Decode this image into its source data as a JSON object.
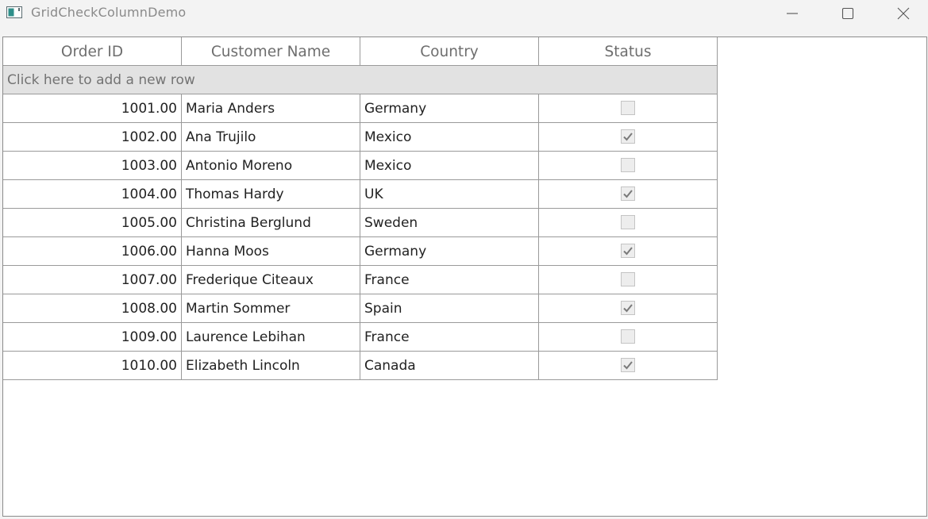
{
  "window": {
    "title": "GridCheckColumnDemo"
  },
  "grid": {
    "columns": [
      "Order ID",
      "Customer Name",
      "Country",
      "Status"
    ],
    "add_row_text": "Click here to add a new row",
    "rows": [
      {
        "order_id": "1001.00",
        "customer": "Maria Anders",
        "country": "Germany",
        "status": false
      },
      {
        "order_id": "1002.00",
        "customer": "Ana Trujilo",
        "country": "Mexico",
        "status": true
      },
      {
        "order_id": "1003.00",
        "customer": "Antonio Moreno",
        "country": "Mexico",
        "status": false
      },
      {
        "order_id": "1004.00",
        "customer": "Thomas Hardy",
        "country": "UK",
        "status": true
      },
      {
        "order_id": "1005.00",
        "customer": "Christina Berglund",
        "country": "Sweden",
        "status": false
      },
      {
        "order_id": "1006.00",
        "customer": "Hanna Moos",
        "country": "Germany",
        "status": true
      },
      {
        "order_id": "1007.00",
        "customer": "Frederique Citeaux",
        "country": "France",
        "status": false
      },
      {
        "order_id": "1008.00",
        "customer": "Martin Sommer",
        "country": "Spain",
        "status": true
      },
      {
        "order_id": "1009.00",
        "customer": "Laurence Lebihan",
        "country": "France",
        "status": false
      },
      {
        "order_id": "1010.00",
        "customer": "Elizabeth Lincoln",
        "country": "Canada",
        "status": true
      }
    ]
  }
}
